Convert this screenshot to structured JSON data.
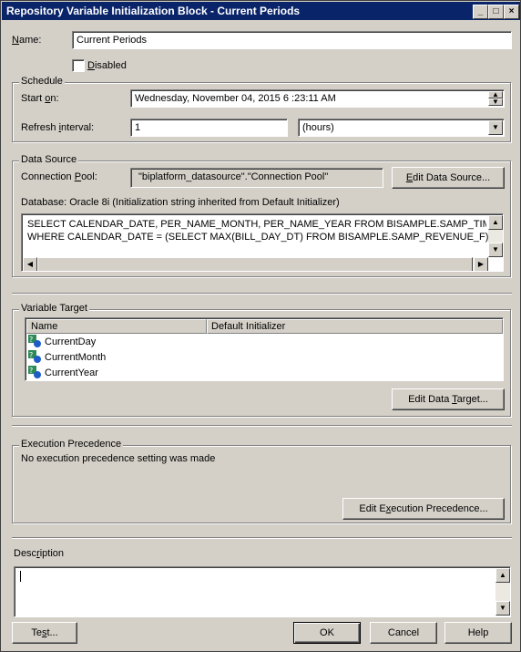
{
  "window": {
    "title": "Repository Variable Initialization Block - Current Periods",
    "min": "_",
    "max": "□",
    "close": "×"
  },
  "name": {
    "label": "Name:",
    "label_accel": "N",
    "label_rest": "ame:",
    "value": "Current Periods"
  },
  "disabled": {
    "label": "Disabled",
    "accel": "D",
    "rest": "isabled",
    "checked": false
  },
  "schedule": {
    "legend": "Schedule",
    "start_label_pre": "Start ",
    "start_label_accel": "o",
    "start_label_post": "n:",
    "start_value": "Wednesday, November 04, 2015  6 :23:11 AM",
    "refresh_label_pre": "Refresh ",
    "refresh_label_accel": "i",
    "refresh_label_post": "nterval:",
    "refresh_value": "1",
    "unit_value": "(hours)"
  },
  "data_source": {
    "legend": "Data Source",
    "conn_label_pre": "Connection ",
    "conn_label_accel": "P",
    "conn_label_post": "ool:",
    "conn_value": "\"biplatform_datasource\".\"Connection Pool\"",
    "edit_pre": "",
    "edit_accel": "E",
    "edit_post": "dit Data Source...",
    "database_text": "Database: Oracle 8i (Initialization string inherited from Default Initializer)",
    "sql_line1": "SELECT CALENDAR_DATE, PER_NAME_MONTH, PER_NAME_YEAR FROM BISAMPLE.SAMP_TIME_DAY_D",
    "sql_line2": "WHERE CALENDAR_DATE = (SELECT MAX(BILL_DAY_DT) FROM BISAMPLE.SAMP_REVENUE_F)"
  },
  "variable_target": {
    "legend": "Variable Target",
    "columns": [
      "Name",
      "Default Initializer"
    ],
    "rows": [
      "CurrentDay",
      "CurrentMonth",
      "CurrentYear"
    ],
    "edit_pre": "Edit Data ",
    "edit_accel": "T",
    "edit_post": "arget..."
  },
  "execution": {
    "legend": "Execution Precedence",
    "text": "No execution precedence setting was made",
    "edit_pre": "Edit E",
    "edit_accel": "x",
    "edit_post": "ecution Precedence..."
  },
  "description": {
    "label_pre": "Desc",
    "label_accel": "r",
    "label_post": "iption",
    "value": ""
  },
  "footer": {
    "test_pre": "Te",
    "test_accel": "s",
    "test_post": "t...",
    "ok": "OK",
    "cancel": "Cancel",
    "help": "Help"
  }
}
